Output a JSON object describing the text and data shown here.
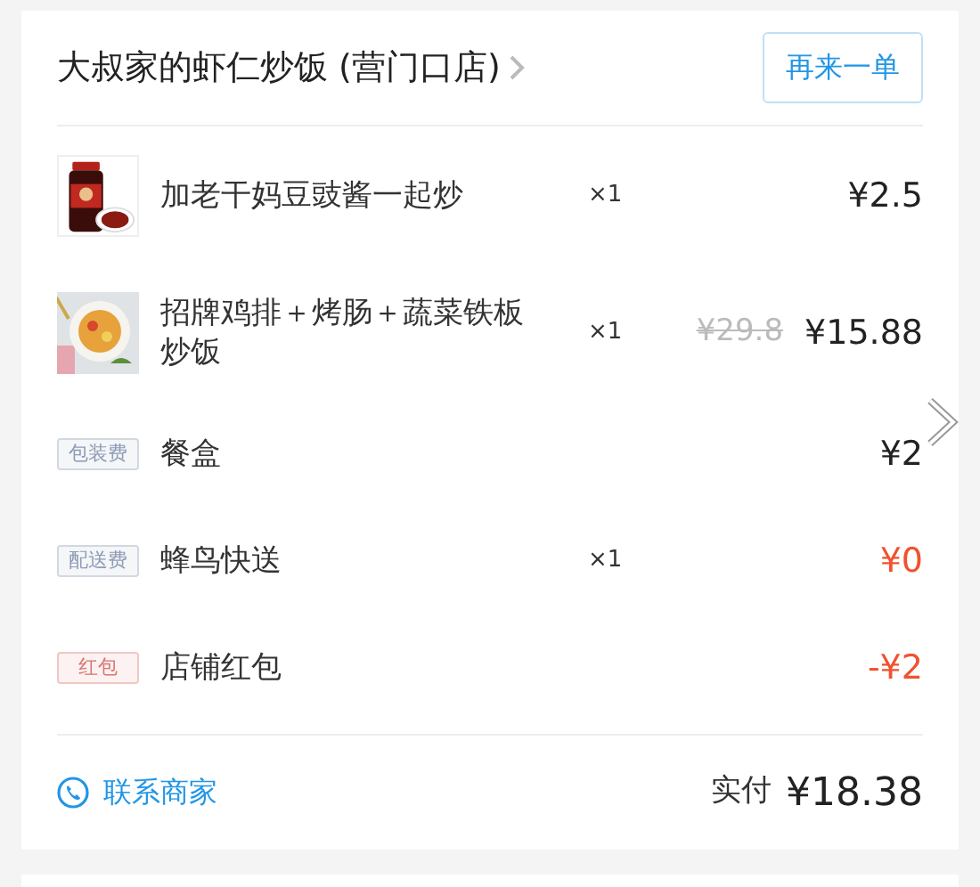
{
  "shop": {
    "name": "大叔家的虾仁炒饭 (营门口店)",
    "reorder_button": "再来一单"
  },
  "rows": [
    {
      "kind": "product",
      "name": "加老干妈豆豉酱一起炒",
      "quantity": "×1",
      "price": "¥2.5",
      "highlight": false
    },
    {
      "kind": "product",
      "name": "招牌鸡排＋烤肠＋蔬菜铁板炒饭",
      "quantity": "×1",
      "original_price": "¥29.8",
      "price": "¥15.88",
      "highlight": false
    },
    {
      "kind": "fee",
      "tag": "包装费",
      "color": "#8e9bb5",
      "name": "餐盒",
      "price": "¥2",
      "highlight": false
    },
    {
      "kind": "fee",
      "tag": "配送费",
      "color": "#8e9bb5",
      "name": "蜂鸟快送",
      "quantity": "×1",
      "price": "¥0",
      "highlight": true
    },
    {
      "kind": "fee",
      "tag": "红包",
      "color": "#d9756f",
      "name": "店铺红包",
      "price": "-¥2",
      "highlight": true
    }
  ],
  "footer": {
    "contact": "联系商家",
    "paid_label": "实付",
    "paid_amount": "¥18.38"
  }
}
